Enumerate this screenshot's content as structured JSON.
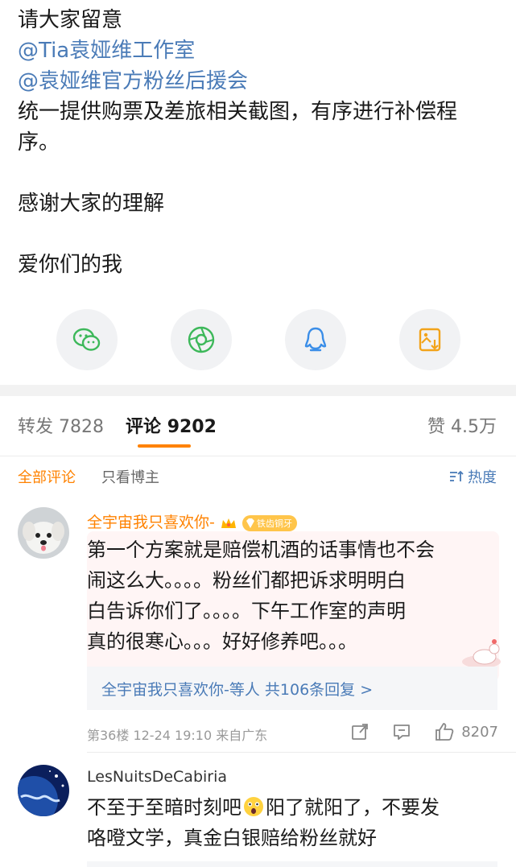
{
  "post": {
    "line1": "请大家留意",
    "mention1": "@Tia袁娅维工作室",
    "mention2": "@袁娅维官方粉丝后援会",
    "line4a": "统一提供购票及差旅相关截图，有序进行补偿程",
    "line4b": "序。",
    "line5": "感谢大家的理解",
    "line6": "爱你们的我"
  },
  "share": [
    {
      "icon": "wechat-icon",
      "color": "#3db85a"
    },
    {
      "icon": "moments-icon",
      "color": "#3db85a"
    },
    {
      "icon": "qq-icon",
      "color": "#3b8ee8"
    },
    {
      "icon": "save-image-icon",
      "color": "#f2a31a"
    }
  ],
  "stats": {
    "repost_label": "转发",
    "repost_count": "7828",
    "comment_label": "评论",
    "comment_count": "9202",
    "like_label": "赞",
    "like_count": "4.5万",
    "accent": "#ff8200"
  },
  "filters": {
    "all": "全部评论",
    "owner": "只看博主",
    "sort": "热度"
  },
  "comments": [
    {
      "name": "全宇宙我只喜欢你-",
      "badge": "铁齿铜牙",
      "lines": [
        "第一个方案就是赔偿机酒的话事情也不会",
        "闹这么大。。。。粉丝们都把诉求明明白",
        "白告诉你们了。。。。下午工作室的声明",
        "真的很寒心。。。好好修养吧。。。"
      ],
      "reply_text": "全宇宙我只喜欢你-等人",
      "reply_count": "共106条回复 >",
      "meta": "第36楼 12-24 19:10 来自广东",
      "likes": "8207"
    },
    {
      "name": "LesNuitsDeCabiria",
      "line1a": "不至于至暗时刻吧",
      "line1b": "阳了就阳了，不要发",
      "line2": "咯噔文学，真金白银赔给粉丝就好"
    }
  ]
}
